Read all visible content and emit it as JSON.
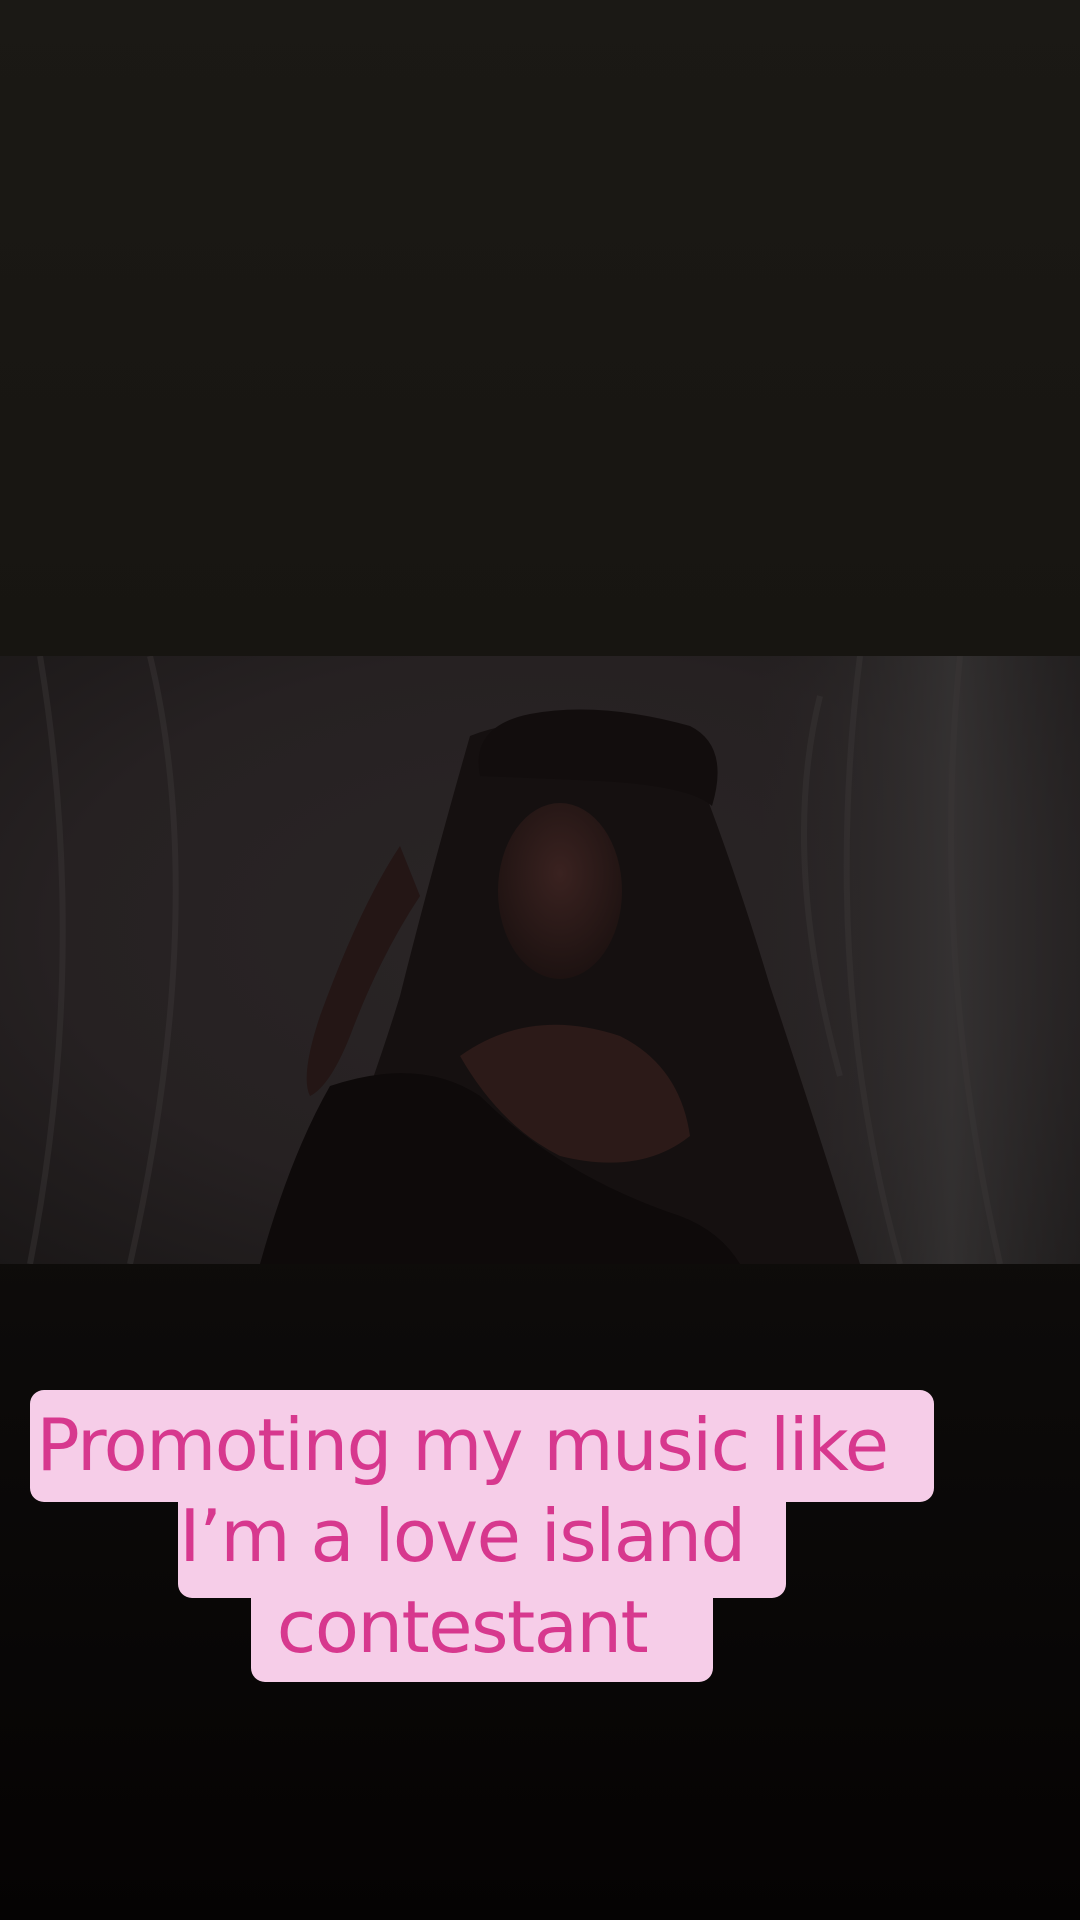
{
  "caption": {
    "line1": "Promoting my music like",
    "line2": "I’m a love island",
    "line3": "contestant"
  },
  "colors": {
    "caption_background": "#f6cde8",
    "caption_text": "#d7388e",
    "backdrop": "#1b1915"
  }
}
